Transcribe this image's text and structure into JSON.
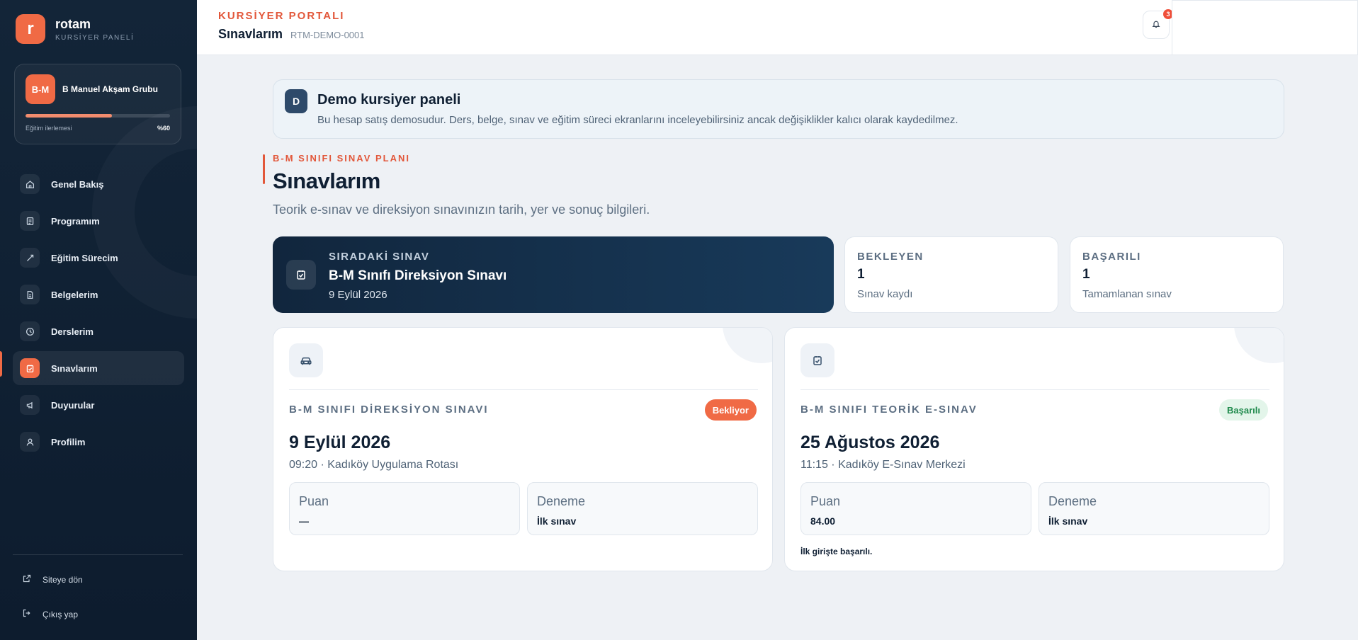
{
  "brand": {
    "logo_letter": "r",
    "name": "rotam",
    "subtitle": "KURSİYER PANELİ",
    "accent_color": "#f06a45",
    "sidebar_color": "#132538"
  },
  "progress_card": {
    "avatar": "B-M",
    "group_name": "B Manuel Akşam Grubu",
    "label": "Eğitim ilerlemesi",
    "value_text": "%60",
    "progress_fraction": 0.6
  },
  "nav": {
    "items": [
      {
        "label": "Genel Bakış",
        "icon": "home-icon"
      },
      {
        "label": "Programım",
        "icon": "schedule-icon"
      },
      {
        "label": "Eğitim Sürecim",
        "icon": "route-icon"
      },
      {
        "label": "Belgelerim",
        "icon": "document-icon"
      },
      {
        "label": "Derslerim",
        "icon": "clock-icon"
      },
      {
        "label": "Sınavlarım",
        "icon": "exam-check-icon",
        "active": true
      },
      {
        "label": "Duyurular",
        "icon": "megaphone-icon"
      },
      {
        "label": "Profilim",
        "icon": "user-icon"
      }
    ]
  },
  "footer_links": {
    "back_to_site": "Siteye dön",
    "logout": "Çıkış yap"
  },
  "header": {
    "kicker": "KURSİYER PORTALI",
    "title": "Sınavlarım",
    "code": "RTM-DEMO-0001",
    "notification_count": "3"
  },
  "demo_banner": {
    "badge": "D",
    "title": "Demo kursiyer paneli",
    "text": "Bu hesap satış demosudur. Ders, belge, sınav ve eğitim süreci ekranlarını inceleyebilirsiniz ancak değişiklikler kalıcı olarak kaydedilmez."
  },
  "section": {
    "kicker": "B-M SINIFI SINAV PLANI",
    "title": "Sınavlarım",
    "subtitle": "Teorik e-sınav ve direksiyon sınavınızın tarih, yer ve sonuç bilgileri."
  },
  "next_exam": {
    "kicker": "SIRADAKİ SINAV",
    "title": "B-M Sınıfı Direksiyon Sınavı",
    "date": "9 Eylül 2026"
  },
  "stats": {
    "pending": {
      "kicker": "BEKLEYEN",
      "value": "1",
      "desc": "Sınav kaydı"
    },
    "passed": {
      "kicker": "BAŞARILI",
      "value": "1",
      "desc": "Tamamlanan sınav"
    }
  },
  "exams": [
    {
      "type": "B-M SINIFI DİREKSİYON SINAVI",
      "status": "Bekliyor",
      "date": "9 Eylül 2026",
      "info": "09:20 · Kadıköy Uygulama Rotası",
      "score_label": "Puan",
      "score": "—",
      "attempt_label": "Deneme",
      "attempt": "İlk sınav",
      "note": ""
    },
    {
      "type": "B-M SINIFI TEORİK E-SINAV",
      "status": "Başarılı",
      "date": "25 Ağustos 2026",
      "info": "11:15 · Kadıköy E-Sınav Merkezi",
      "score_label": "Puan",
      "score": "84.00",
      "attempt_label": "Deneme",
      "attempt": "İlk sınav",
      "note": "İlk girişte başarılı."
    }
  ]
}
